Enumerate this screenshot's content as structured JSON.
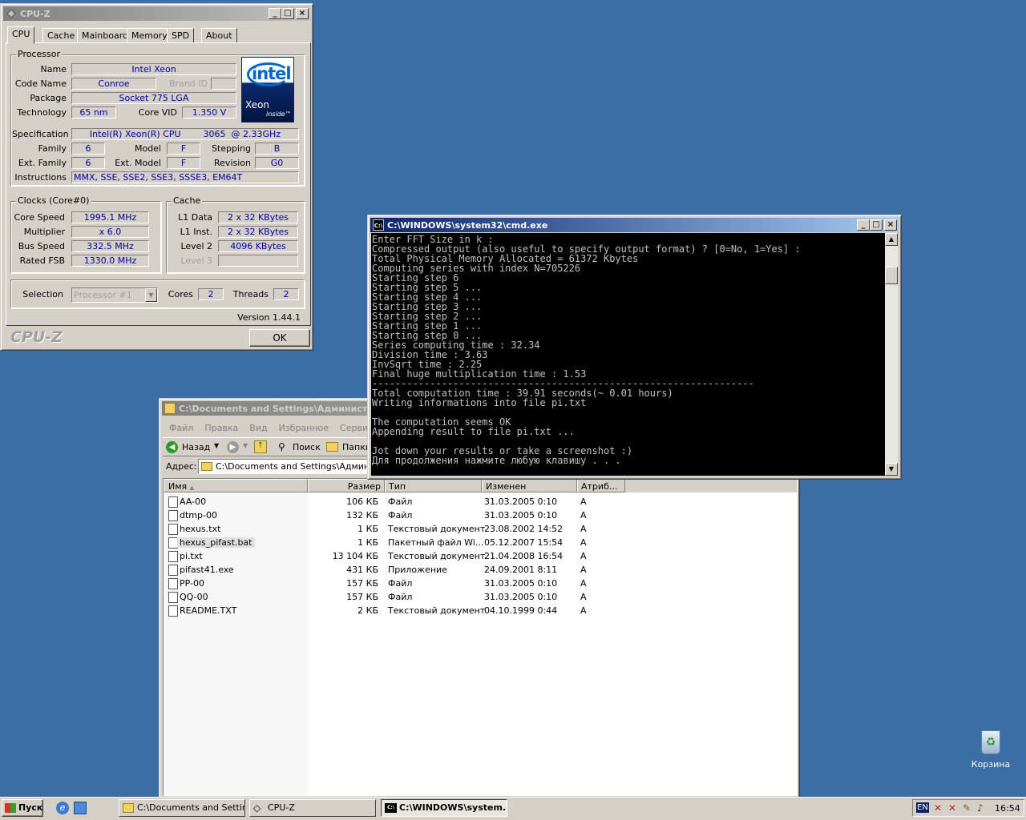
{
  "cpuz": {
    "title": "CPU-Z",
    "tabs": [
      "CPU",
      "Cache",
      "Mainboard",
      "Memory",
      "SPD",
      "About"
    ],
    "processor_group": "Processor",
    "labels": {
      "name": "Name",
      "codename": "Code Name",
      "brandid": "Brand ID",
      "package": "Package",
      "technology": "Technology",
      "corevid": "Core VID",
      "spec": "Specification",
      "family": "Family",
      "model": "Model",
      "stepping": "Stepping",
      "extfamily": "Ext. Family",
      "extmodel": "Ext. Model",
      "revision": "Revision",
      "instructions": "Instructions"
    },
    "values": {
      "name": "Intel Xeon",
      "codename": "Conroe",
      "package": "Socket 775 LGA",
      "technology": "65 nm",
      "corevid": "1.350 V",
      "spec": "Intel(R) Xeon(R) CPU        3065  @ 2.33GHz",
      "family": "6",
      "model": "F",
      "stepping": "B",
      "extfamily": "6",
      "extmodel": "F",
      "revision": "G0",
      "instructions": "MMX, SSE, SSE2, SSE3, SSSE3, EM64T"
    },
    "logo": {
      "brand": "intel",
      "product": "Xeon",
      "sub": "inside™"
    },
    "clocks_group": "Clocks (Core#0)",
    "clocks": {
      "core_speed_l": "Core Speed",
      "core_speed": "1995.1 MHz",
      "multiplier_l": "Multiplier",
      "multiplier": "x 6.0",
      "bus_speed_l": "Bus Speed",
      "bus_speed": "332.5 MHz",
      "rated_fsb_l": "Rated FSB",
      "rated_fsb": "1330.0 MHz"
    },
    "cache_group": "Cache",
    "cache": {
      "l1d_l": "L1 Data",
      "l1d": "2 x 32 KBytes",
      "l1i_l": "L1 Inst.",
      "l1i": "2 x 32 KBytes",
      "l2_l": "Level 2",
      "l2": "4096 KBytes",
      "l3_l": "Level 3",
      "l3": ""
    },
    "selection_l": "Selection",
    "selection": "Processor #1",
    "cores_l": "Cores",
    "cores": "2",
    "threads_l": "Threads",
    "threads": "2",
    "version": "Version 1.44.1",
    "brand_footer": "CPU-Z",
    "ok": "OK"
  },
  "cmd": {
    "title": "C:\\WINDOWS\\system32\\cmd.exe",
    "lines": [
      "Enter FFT Size in k :",
      "Compressed output (also useful to specify output format) ? [0=No, 1=Yes] :",
      "Total Physical Memory Allocated = 61372 Kbytes",
      "Computing series with index N=705226",
      "Starting step 6",
      "Starting step 5 ...",
      "Starting step 4 ...",
      "Starting step 3 ...",
      "Starting step 2 ...",
      "Starting step 1 ...",
      "Starting step 0 ...",
      "Series computing time : 32.34",
      "Division time : 3.63",
      "InvSqrt time : 2.25",
      "Final huge multiplication time : 1.53",
      "------------------------------------------------------------------",
      "Total computation time : 39.91 seconds(~ 0.01 hours)",
      "Writing informations into file pi.txt",
      "",
      "The computation seems OK",
      "Appending result to file pi.txt ...",
      "",
      "Jot down your results or take a screenshot :)",
      "Для продолжения нажмите любую клавишу . . ."
    ]
  },
  "explorer": {
    "title": "C:\\Documents and Settings\\Администрат",
    "menu": [
      "Файл",
      "Правка",
      "Вид",
      "Избранное",
      "Сервис"
    ],
    "back": "Назад",
    "search": "Поиск",
    "folders": "Папки",
    "address_label": "Адрес:",
    "address": "C:\\Documents and Settings\\Администрат",
    "columns": [
      "Имя",
      "Размер",
      "Тип",
      "Изменен",
      "Атриб..."
    ],
    "files": [
      {
        "name": "AA-00",
        "size": "106 КБ",
        "type": "Файл",
        "date": "31.03.2005 0:10",
        "attr": "A"
      },
      {
        "name": "dtmp-00",
        "size": "132 КБ",
        "type": "Файл",
        "date": "31.03.2005 0:10",
        "attr": "A"
      },
      {
        "name": "hexus.txt",
        "size": "1 КБ",
        "type": "Текстовый документ",
        "date": "23.08.2002 14:52",
        "attr": "A"
      },
      {
        "name": "hexus_pifast.bat",
        "size": "1 КБ",
        "type": "Пакетный файл Wi...",
        "date": "05.12.2007 15:54",
        "attr": "A"
      },
      {
        "name": "pi.txt",
        "size": "13 104 КБ",
        "type": "Текстовый документ",
        "date": "21.04.2008 16:54",
        "attr": "A"
      },
      {
        "name": "pifast41.exe",
        "size": "431 КБ",
        "type": "Приложение",
        "date": "24.09.2001 8:11",
        "attr": "A"
      },
      {
        "name": "PP-00",
        "size": "157 КБ",
        "type": "Файл",
        "date": "31.03.2005 0:10",
        "attr": "A"
      },
      {
        "name": "QQ-00",
        "size": "157 КБ",
        "type": "Файл",
        "date": "31.03.2005 0:10",
        "attr": "A"
      },
      {
        "name": "README.TXT",
        "size": "2 КБ",
        "type": "Текстовый документ",
        "date": "04.10.1999 0:44",
        "attr": "A"
      }
    ]
  },
  "desktop": {
    "recycle_bin": "Корзина"
  },
  "taskbar": {
    "start": "Пуск",
    "tasks": [
      "C:\\Documents and Settin...",
      "CPU-Z",
      "C:\\WINDOWS\\system..."
    ],
    "lang": "EN",
    "clock": "16:54"
  }
}
